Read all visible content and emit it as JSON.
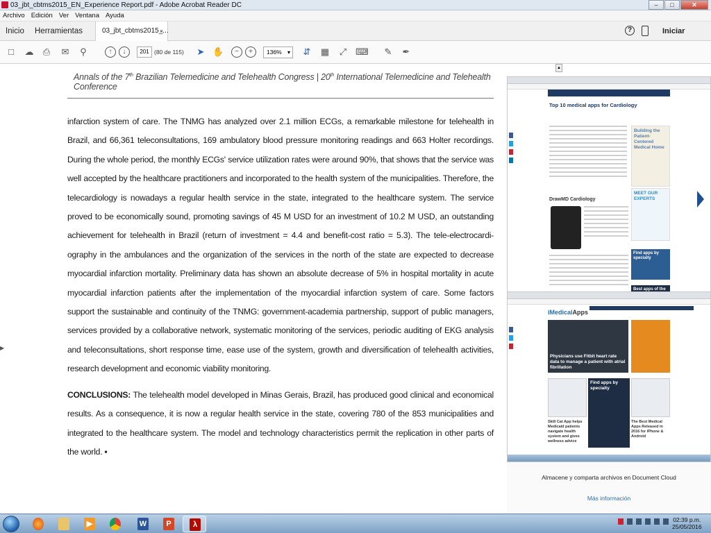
{
  "window": {
    "title": "03_jbt_cbtms2015_EN_Experience Report.pdf - Adobe Acrobat Reader DC",
    "minimize": "–",
    "maximize": "□",
    "close": "✕"
  },
  "menu": [
    "Archivo",
    "Edición",
    "Ver",
    "Ventana",
    "Ayuda"
  ],
  "tabs": {
    "home": "Inicio",
    "tools": "Herramientas",
    "document": "03_jbt_cbtms2015_...",
    "close": "×",
    "help": "?",
    "signin": "Iniciar sesión"
  },
  "toolbar": {
    "page_current": "201",
    "page_count": "(80 de 115)",
    "zoom": "136%"
  },
  "document": {
    "header": {
      "pre": "Annals of the 7",
      "sup1": "th",
      "mid": " Brazilian Telemedicine and Telehealth Congress | 20",
      "sup2": "th",
      "post": " International Telemedicine and Telehealth Conference"
    },
    "body": "infarction system of care. The TNMG has analyzed over 2.1 million ECGs, a remarkable milestone for telehealth in Brazil, and 66,361 teleconsultations, 169 ambulatory blood pressure monitoring readings and 663 Holter recordings. During the whole period, the monthly ECGs' service utilization rates were around 90%, that shows that the service was well accepted by the healthcare practitioners and incorporated to the health system of the municipalities. Therefore, the telecardiology is nowadays a regular health service in the state, integrated to the healthcare system. The service proved to be economically sound, promoting savings of 45 M USD for an investment of 10.2 M USD, an outstanding achievement for telehealth in Brazil (return of investment = 4.4 and benefit-cost ratio = 5.3). The tele-electrocardi-ography in the ambulances and the organization of the services in the north of the state are expected to decrease myocardial infarction mortality. Preliminary data has shown an absolute decrease of 5% in hospital mortality in acute myocardial infarction patients after the implementation of the myocardial infarction system of care. Some factors support the sustainable and continuity of the TNMG: government-academia partnership, support of public managers, services provided by a collaborative network, systematic  monitoring of the services, periodic auditing of EKG analysis and teleconsultations, short response time, ease use of the system, growth and diversification of telehealth activities, research development and economic viability monitoring.",
    "conclusions_label": "CONCLUSIONS:",
    "conclusions_text": " The telehealth model developed in Minas Gerais, Brazil, has produced good clinical and economical results. As a consequence, it is now a regular health service in the state, covering 780 of the 853 municipalities and integrated to the healthcare system. The model and technology characteristics permit the replication in other parts of the world. ▪"
  },
  "figure": {
    "shot1_title": "Top 10 medical apps for Cardiology",
    "shot1_sub": "DrawMD Cardiology",
    "shot1_ad1": "Building the Patient-Centered Medical Home",
    "shot1_ad2": "MEET OUR EXPERTS",
    "shot1_ad3": "Find apps by specialty",
    "shot1_ad4": "Best apps of the month",
    "shot2_logo_a": "iMedical",
    "shot2_logo_b": "Apps",
    "shot2_headline": "Physicians use Fitbit heart rate data to manage a patient with atrial fibrillation",
    "shot2_finder": "Find apps by specialty",
    "shot2_caption1": "Skill Cat App helps Medicaid patients navigate health system and gives wellness advice",
    "shot2_caption2": "The Best Medical Apps Released in 2016 for iPhone & Android"
  },
  "cloud_panel": {
    "text": "Almacene y comparta archivos en Document Cloud",
    "link": "Más información"
  },
  "taskbar": {
    "time": "02:39 p.m.",
    "date": "25/05/2016",
    "apps": [
      "firefox",
      "explorer",
      "media-player",
      "chrome",
      "word",
      "powerpoint",
      "acrobat"
    ]
  },
  "colors": {
    "acrobat_red": "#c8102e",
    "link_blue": "#2b6ea6",
    "nav_navy": "#1f3a63"
  }
}
